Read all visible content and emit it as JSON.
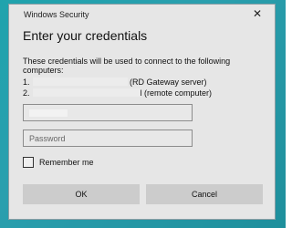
{
  "window": {
    "title": "Windows Security",
    "close_glyph": "✕"
  },
  "heading": "Enter your credentials",
  "description": "These credentials will be used to connect to the following computers:",
  "computers": [
    {
      "index": "1.",
      "suffix": "(RD Gateway server)"
    },
    {
      "index": "2.",
      "suffix": "l (remote computer)"
    }
  ],
  "username": {
    "value": "",
    "placeholder": ""
  },
  "password": {
    "placeholder": "Password"
  },
  "remember": {
    "label": "Remember me",
    "checked": false
  },
  "buttons": {
    "ok": "OK",
    "cancel": "Cancel"
  },
  "icons": {
    "close": "close-icon"
  },
  "colors": {
    "backdrop": "#1fa3ad",
    "dialog": "#e6e6e6",
    "button": "#cccccc"
  }
}
